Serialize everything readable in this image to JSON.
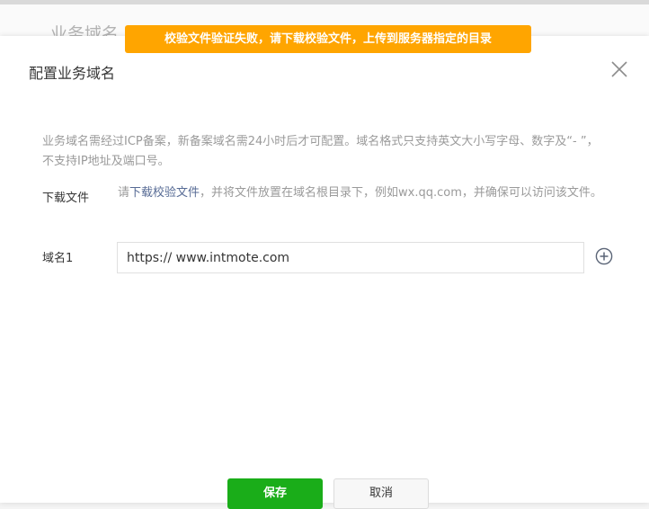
{
  "background": {
    "title": "业务域名"
  },
  "toast": {
    "message": "校验文件验证失败，请下载校验文件，上传到服务器指定的目录"
  },
  "dialog": {
    "title": "配置业务域名",
    "description": "业务域名需经过ICP备案，新备案域名需24小时后才可配置。域名格式只支持英文大小写字母、数字及“- ”，不支持IP地址及端口号。",
    "download": {
      "label": "下载文件",
      "prefix": "请",
      "link": "下载校验文件",
      "suffix": "，并将文件放置在域名根目录下，例如wx.qq.com，并确保可以访问该文件。"
    },
    "domain": {
      "label": "域名1",
      "value": "https:// www.intmote.com"
    },
    "buttons": {
      "save": "保存",
      "cancel": "取消"
    }
  },
  "colors": {
    "toast": "#ffa500",
    "primary": "#1aad19",
    "link": "#576b95"
  },
  "icons": {
    "close": "close-icon",
    "add": "plus-circle-icon"
  }
}
